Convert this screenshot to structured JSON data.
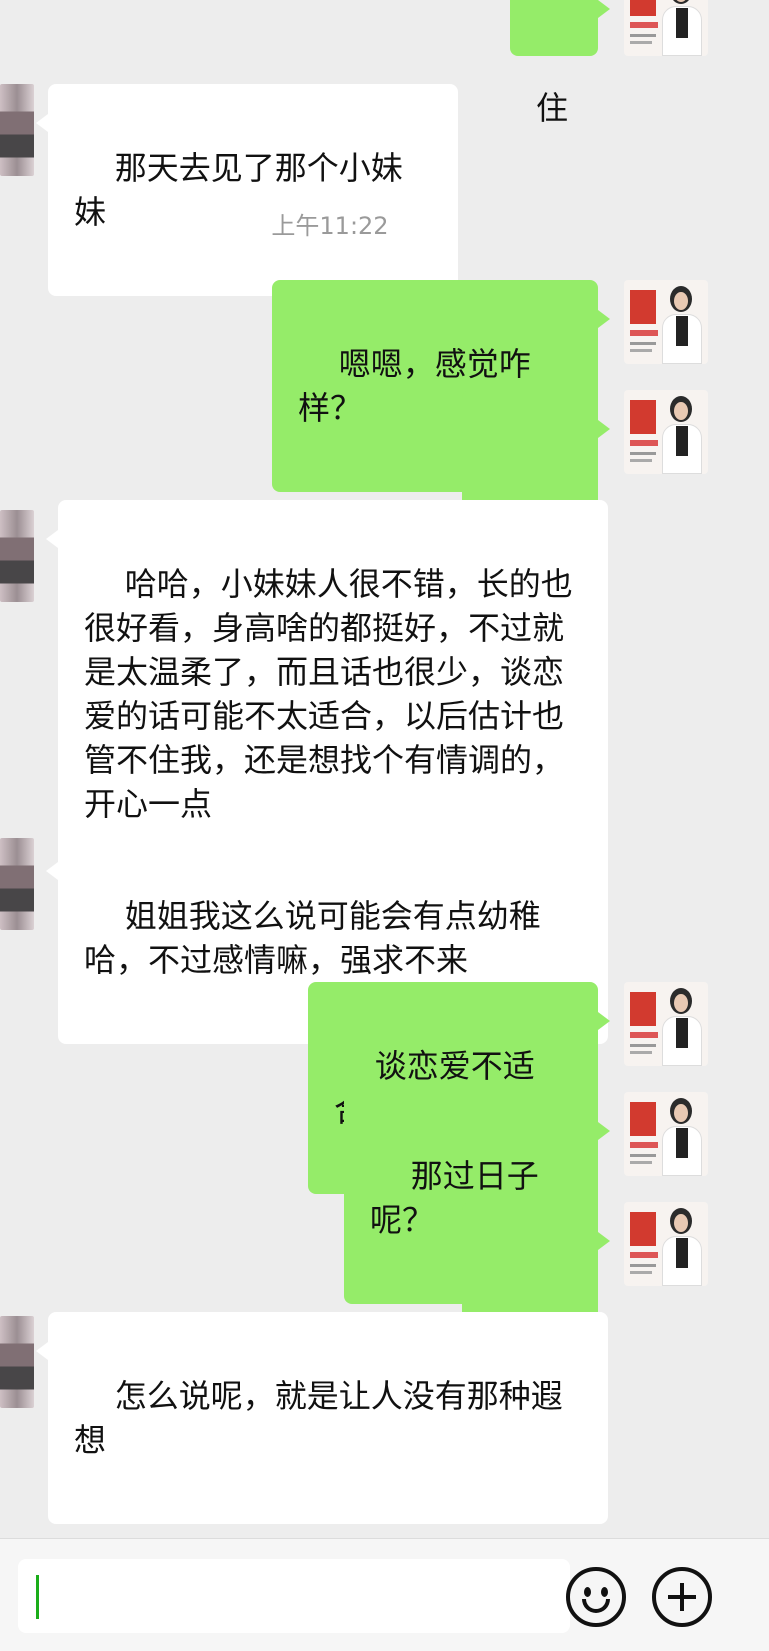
{
  "messages": [
    {
      "id": 0,
      "side": "out",
      "text": "住"
    },
    {
      "id": 1,
      "side": "in",
      "text": "那天去见了那个小妹妹"
    },
    {
      "id": 2,
      "side": "time",
      "text": "上午11:22"
    },
    {
      "id": 3,
      "side": "out",
      "text": "嗯嗯，感觉咋样？"
    },
    {
      "id": 4,
      "side": "out",
      "emoji": [
        "🤦",
        "🤦"
      ]
    },
    {
      "id": 5,
      "side": "in",
      "text": "哈哈，小妹妹人很不错，长的也很好看，身高啥的都挺好，不过就是太温柔了，而且话也很少，谈恋爱的话可能不太适合，以后估计也管不住我，还是想找个有情调的，开心一点"
    },
    {
      "id": 6,
      "side": "in",
      "text": "姐姐我这么说可能会有点幼稚哈，不过感情嘛，强求不来"
    },
    {
      "id": 7,
      "side": "out",
      "text": "谈恋爱不适合？"
    },
    {
      "id": 8,
      "side": "out",
      "text": "那过日子呢？"
    },
    {
      "id": 9,
      "side": "out",
      "emoji": [
        "😁",
        "😁"
      ]
    },
    {
      "id": 10,
      "side": "in",
      "text": "怎么说呢，就是让人没有那种遐想"
    }
  ],
  "input_bar": {
    "text_value": "",
    "emoji_button": "smiley-icon",
    "more_button": "plus-icon"
  },
  "colors": {
    "background": "#ededed",
    "incoming_bubble": "#ffffff",
    "outgoing_bubble": "#95ec69",
    "timestamp": "#9a9a9a"
  }
}
